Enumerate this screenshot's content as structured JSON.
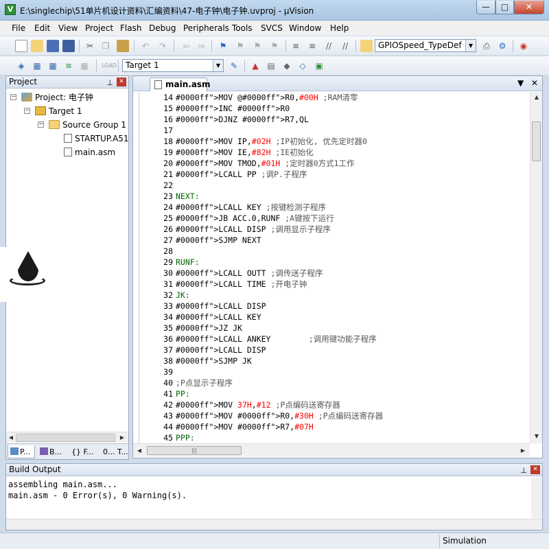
{
  "window": {
    "title": "E:\\singlechip\\51单片机设计资料\\汇编资料\\47-电子钟\\电子钟.uvproj - µVision",
    "app_icon": "V",
    "min": "—",
    "max": "□",
    "close": "✕"
  },
  "menu": [
    "File",
    "Edit",
    "View",
    "Project",
    "Flash",
    "Debug",
    "Peripherals",
    "Tools",
    "SVCS",
    "Window",
    "Help"
  ],
  "toolbar": {
    "find_combo_value": "GPIOSpeed_TypeDef",
    "target_combo_value": "Target 1"
  },
  "project_panel": {
    "title": "Project",
    "tree": {
      "project": "Project: 电子钟",
      "target": "Target 1",
      "group": "Source Group 1",
      "files": [
        "STARTUP.A51",
        "main.asm"
      ]
    },
    "tabs": [
      "P...",
      "B...",
      "{} F...",
      "0... T..."
    ]
  },
  "editor": {
    "tab_label": "main.asm",
    "lines": [
      {
        "n": "14",
        "text": "MOV @R0,#00H ;RAM清零"
      },
      {
        "n": "15",
        "text": "INC R0"
      },
      {
        "n": "16",
        "text": "DJNZ R7,QL"
      },
      {
        "n": "17",
        "text": ""
      },
      {
        "n": "18",
        "text": "MOV IP,#02H ;IP初始化, 优先定时器0"
      },
      {
        "n": "19",
        "text": "MOV IE,#82H ;IE初始化"
      },
      {
        "n": "20",
        "text": "MOV TMOD,#01H ;定时器0方式1工作"
      },
      {
        "n": "21",
        "text": "LCALL PP ;调P.子程序"
      },
      {
        "n": "22",
        "text": ""
      },
      {
        "n": "23",
        "text": "NEXT:"
      },
      {
        "n": "24",
        "text": "LCALL KEY ;按键检测子程序"
      },
      {
        "n": "25",
        "text": "JB ACC.0,RUNF ;A键按下运行"
      },
      {
        "n": "26",
        "text": "LCALL DISP ;调用显示子程序"
      },
      {
        "n": "27",
        "text": "SJMP NEXT"
      },
      {
        "n": "28",
        "text": ""
      },
      {
        "n": "29",
        "text": "RUNF:"
      },
      {
        "n": "30",
        "text": "LCALL OUTT ;调传送子程序"
      },
      {
        "n": "31",
        "text": "LCALL TIME ;开电子钟"
      },
      {
        "n": "32",
        "text": "JK:"
      },
      {
        "n": "33",
        "text": "LCALL DISP"
      },
      {
        "n": "34",
        "text": "LCALL KEY"
      },
      {
        "n": "35",
        "text": "JZ JK"
      },
      {
        "n": "36",
        "text": "LCALL ANKEY        ;调用键功能子程序"
      },
      {
        "n": "37",
        "text": "LCALL DISP"
      },
      {
        "n": "38",
        "text": "SJMP JK"
      },
      {
        "n": "39",
        "text": ""
      },
      {
        "n": "40",
        "text": ";P点显示子程序"
      },
      {
        "n": "41",
        "text": "PP:"
      },
      {
        "n": "42",
        "text": "MOV 37H,#12 ;P点编码送寄存器"
      },
      {
        "n": "43",
        "text": "MOV R0,#30H ;P点编码送寄存器"
      },
      {
        "n": "44",
        "text": "MOV R7,#07H"
      },
      {
        "n": "45",
        "text": "PPP:"
      }
    ]
  },
  "build_output": {
    "title": "Build Output",
    "lines": [
      "assembling main.asm...",
      "main.asm - 0 Error(s), 0 Warning(s)."
    ]
  },
  "status": {
    "mode": "Simulation"
  },
  "colors": {
    "keyword": "#0000ff",
    "number": "#ff0000",
    "label": "#006400",
    "comment": "#555555"
  }
}
